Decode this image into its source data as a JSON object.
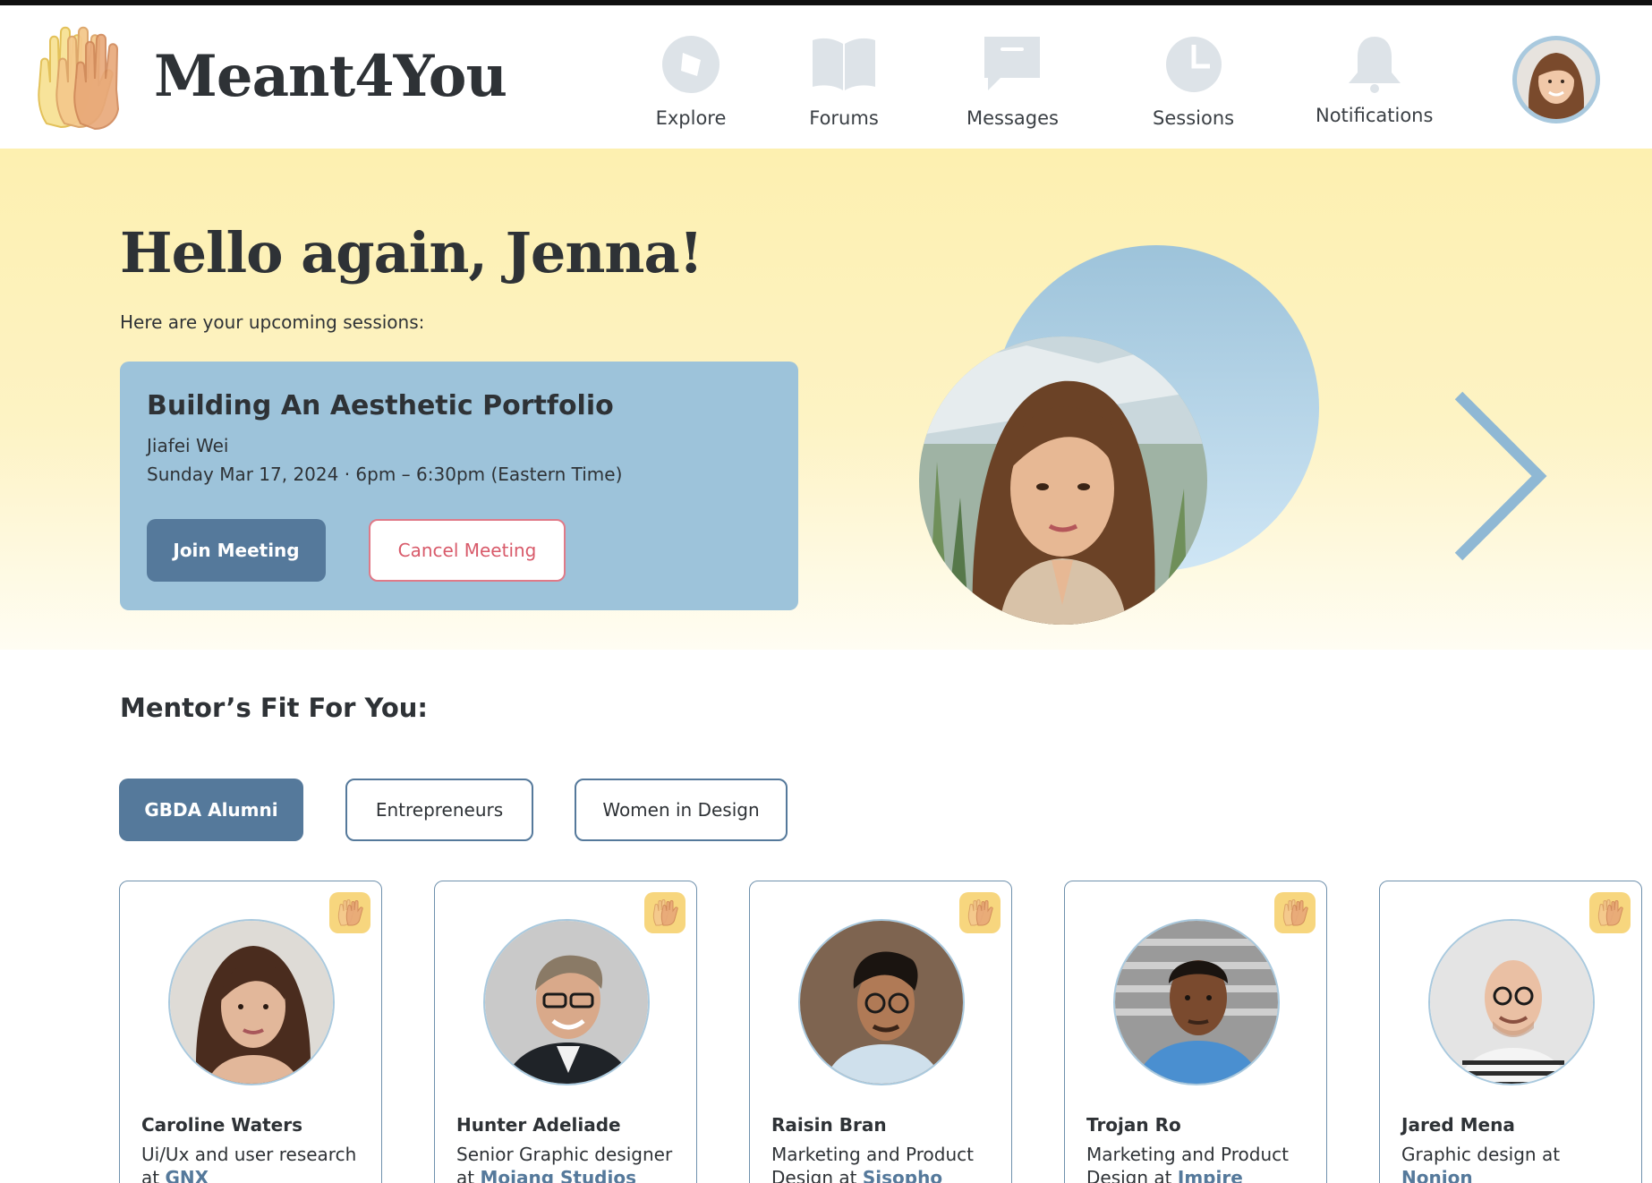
{
  "app": {
    "name": "Meant4You"
  },
  "nav": [
    {
      "label": "Explore",
      "icon": "compass-icon"
    },
    {
      "label": "Forums",
      "icon": "book-icon"
    },
    {
      "label": "Messages",
      "icon": "message-icon"
    },
    {
      "label": "Sessions",
      "icon": "clock-icon"
    },
    {
      "label": "Notifications",
      "icon": "bell-icon"
    }
  ],
  "hero": {
    "greeting": "Hello again, Jenna!",
    "subtitle": "Here are your upcoming sessions:"
  },
  "session": {
    "title": "Building An Aesthetic Portfolio",
    "mentor": "Jiafei Wei",
    "time": "Sunday Mar 17, 2024 · 6pm – 6:30pm (Eastern Time)",
    "join_label": "Join Meeting",
    "cancel_label": "Cancel Meeting"
  },
  "mentors_section": {
    "title": "Mentor’s Fit For You:",
    "filters": [
      {
        "label": "GBDA Alumni",
        "active": true
      },
      {
        "label": "Entrepreneurs",
        "active": false
      },
      {
        "label": "Women in Design",
        "active": false
      }
    ],
    "mentors": [
      {
        "name": "Caroline Waters",
        "role_prefix": "Ui/Ux and user research at ",
        "company": "GNX"
      },
      {
        "name": "Hunter Adeliade",
        "role_prefix": "Senior Graphic designer at ",
        "company": "Mojang Studios"
      },
      {
        "name": "Raisin Bran",
        "role_prefix": "Marketing and Product Design at ",
        "company": "Sisopho"
      },
      {
        "name": "Trojan Ro",
        "role_prefix": "Marketing and Product Design at ",
        "company": "Impire"
      },
      {
        "name": "Jared Mena",
        "role_prefix": "Graphic design at ",
        "company": "Nonion"
      }
    ]
  },
  "colors": {
    "accent": "#55799b",
    "card_blue": "#9dc3da",
    "hero_yellow": "#fdf0b0",
    "cancel_red": "#d85a6a",
    "badge_yellow": "#f7d67e"
  }
}
